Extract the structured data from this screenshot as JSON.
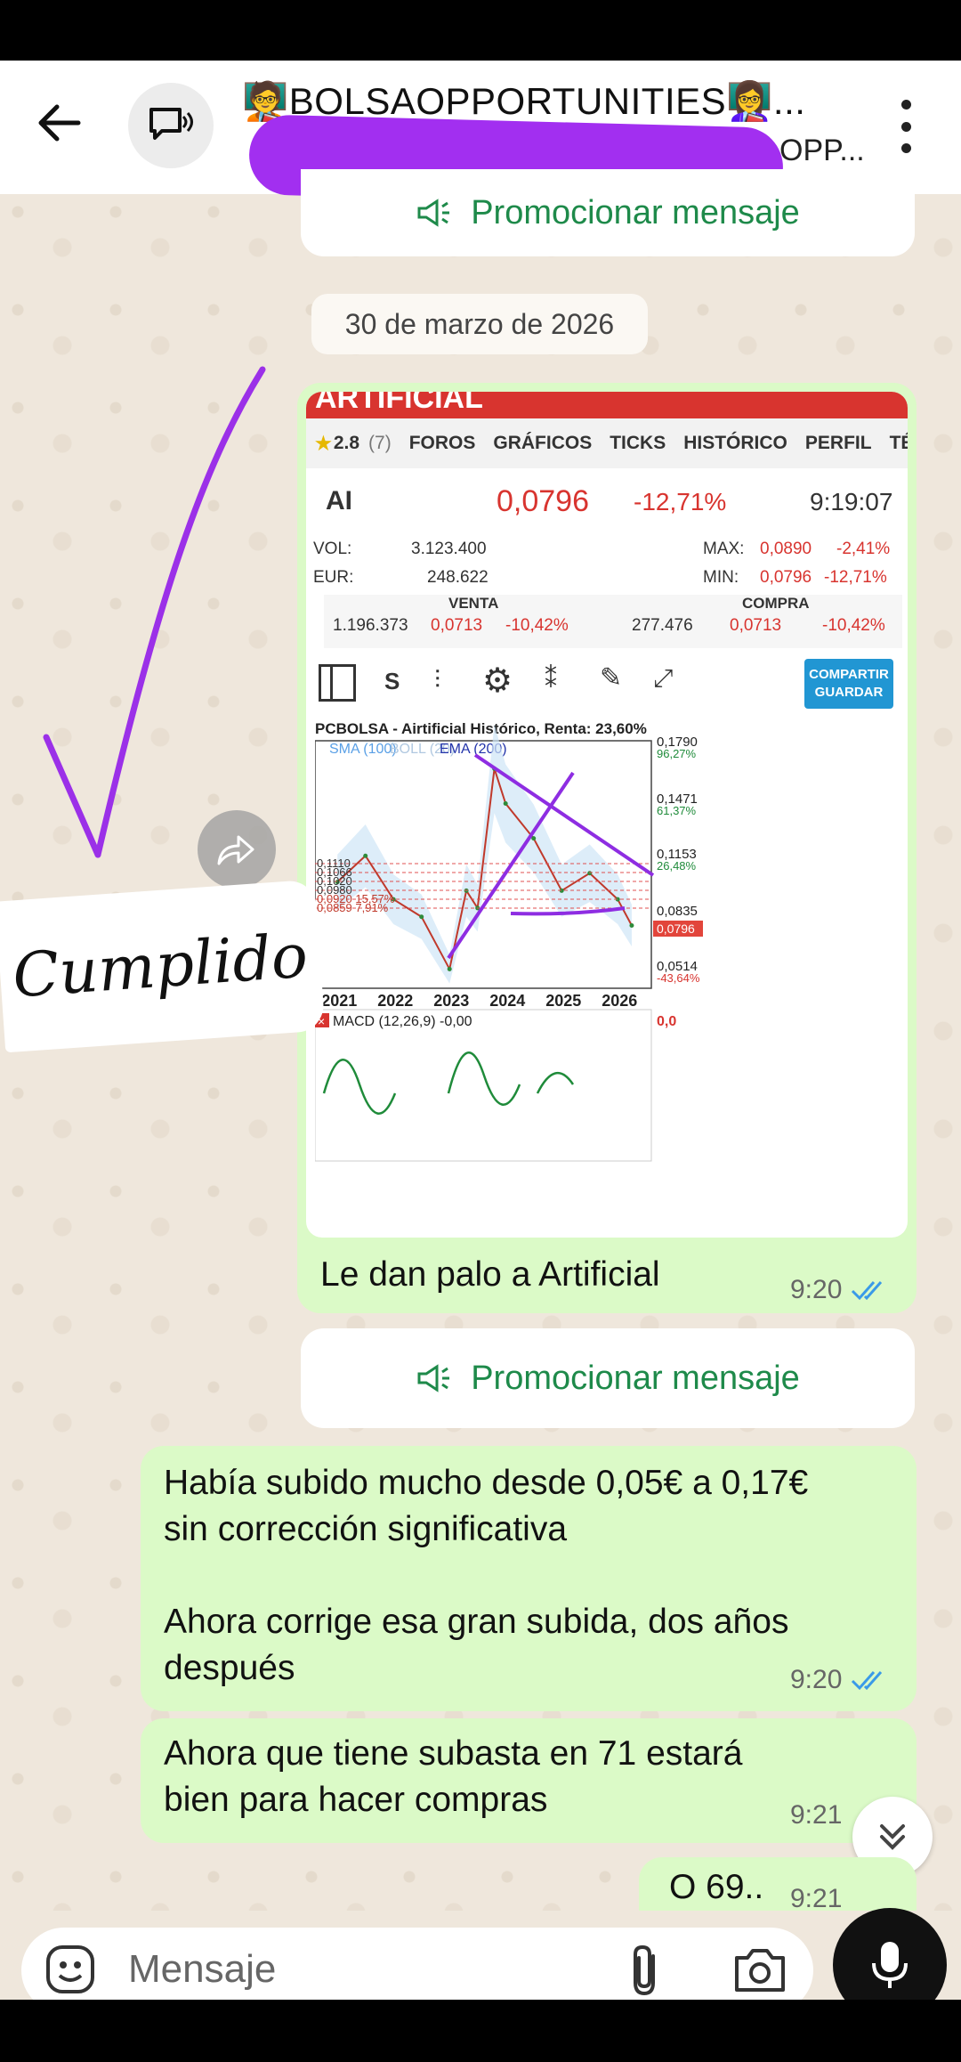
{
  "header": {
    "title": "🧑‍🏫BOLSAOPPORTUNITIES👩‍🏫...",
    "subtitle": "OPP..."
  },
  "promo_label": "Promocionar mensaje",
  "date_chip": "30 de marzo de 2026",
  "annotation": "Cumplido",
  "screenshot": {
    "banner": "ARTIFICIAL",
    "rating": "2.8",
    "rating_badge": "(7)",
    "tabs": [
      "FOROS",
      "GRÁFICOS",
      "TICKS",
      "HISTÓRICO",
      "PERFIL",
      "TÉ"
    ],
    "ticker": "AI",
    "price": "0,0796",
    "change": "-12,71%",
    "time": "9:19:07",
    "vol_label": "VOL:",
    "vol_value": "3.123.400",
    "eur_label": "EUR:",
    "eur_value": "248.622",
    "max_label": "MAX:",
    "max_value": "0,0890",
    "max_pct": "-2,41%",
    "min_label": "MIN:",
    "min_value": "0,0796",
    "min_pct": "-12,71%",
    "venta_label": "VENTA",
    "compra_label": "COMPRA",
    "venta_qty": "1.196.373",
    "venta_price": "0,0713",
    "venta_pct": "-10,42%",
    "compra_qty": "277.476",
    "compra_price": "0,0713",
    "compra_pct": "-10,42%",
    "tool_s": "S",
    "share_btn": "COMPARTIR GUARDAR"
  },
  "chart_data": {
    "type": "line",
    "title": "PCBOLSA - Airtificial Histórico, Renta: 23,60%",
    "legend": [
      "SMA (100)",
      "BOLL (20)",
      "EMA (200)"
    ],
    "x_ticks": [
      "2021",
      "2022",
      "2023",
      "2024",
      "2025",
      "2026"
    ],
    "right_axis": [
      {
        "price": "0,1790",
        "pct": "96,27%"
      },
      {
        "price": "0,1471",
        "pct": "61,37%"
      },
      {
        "price": "0,1153",
        "pct": "26,48%"
      },
      {
        "price": "0,0835",
        "pct": ""
      },
      {
        "price": "0,0514",
        "pct": "-43,64%"
      }
    ],
    "current_price_tag": "0,0796",
    "left_levels": [
      "0,1110",
      "0,1066",
      "0,1020",
      "0,0980",
      "0,0920 15,57%",
      "0,0859 7,91%"
    ],
    "macd_label": "MACD (12,26,9) -0,00",
    "macd_value": "0,0",
    "series": [
      {
        "name": "Price",
        "x": [
          "2021",
          "2021.5",
          "2022",
          "2022.5",
          "2023",
          "2023.3",
          "2023.5",
          "2023.8",
          "2024",
          "2024.5",
          "2025",
          "2025.5",
          "2026",
          "2026.25"
        ],
        "y": [
          0.105,
          0.12,
          0.095,
          0.085,
          0.055,
          0.1,
          0.09,
          0.17,
          0.15,
          0.13,
          0.1,
          0.11,
          0.095,
          0.08
        ]
      }
    ],
    "ylim": [
      0.045,
      0.185
    ]
  },
  "messages": [
    {
      "text": "Le dan palo a Artificial",
      "time": "9:20"
    },
    {
      "line1": "Había subido mucho desde 0,05€ a 0,17€",
      "line2": "sin corrección significativa",
      "line3": "Ahora corrige esa gran subida, dos años",
      "line4": "después",
      "time": "9:20"
    },
    {
      "line1": "Ahora que tiene subasta en 71 estará",
      "line2": "bien para hacer compras",
      "time": "9:21"
    },
    {
      "text": "O 69..",
      "time": "9:21"
    }
  ],
  "input": {
    "placeholder": "Mensaje"
  }
}
